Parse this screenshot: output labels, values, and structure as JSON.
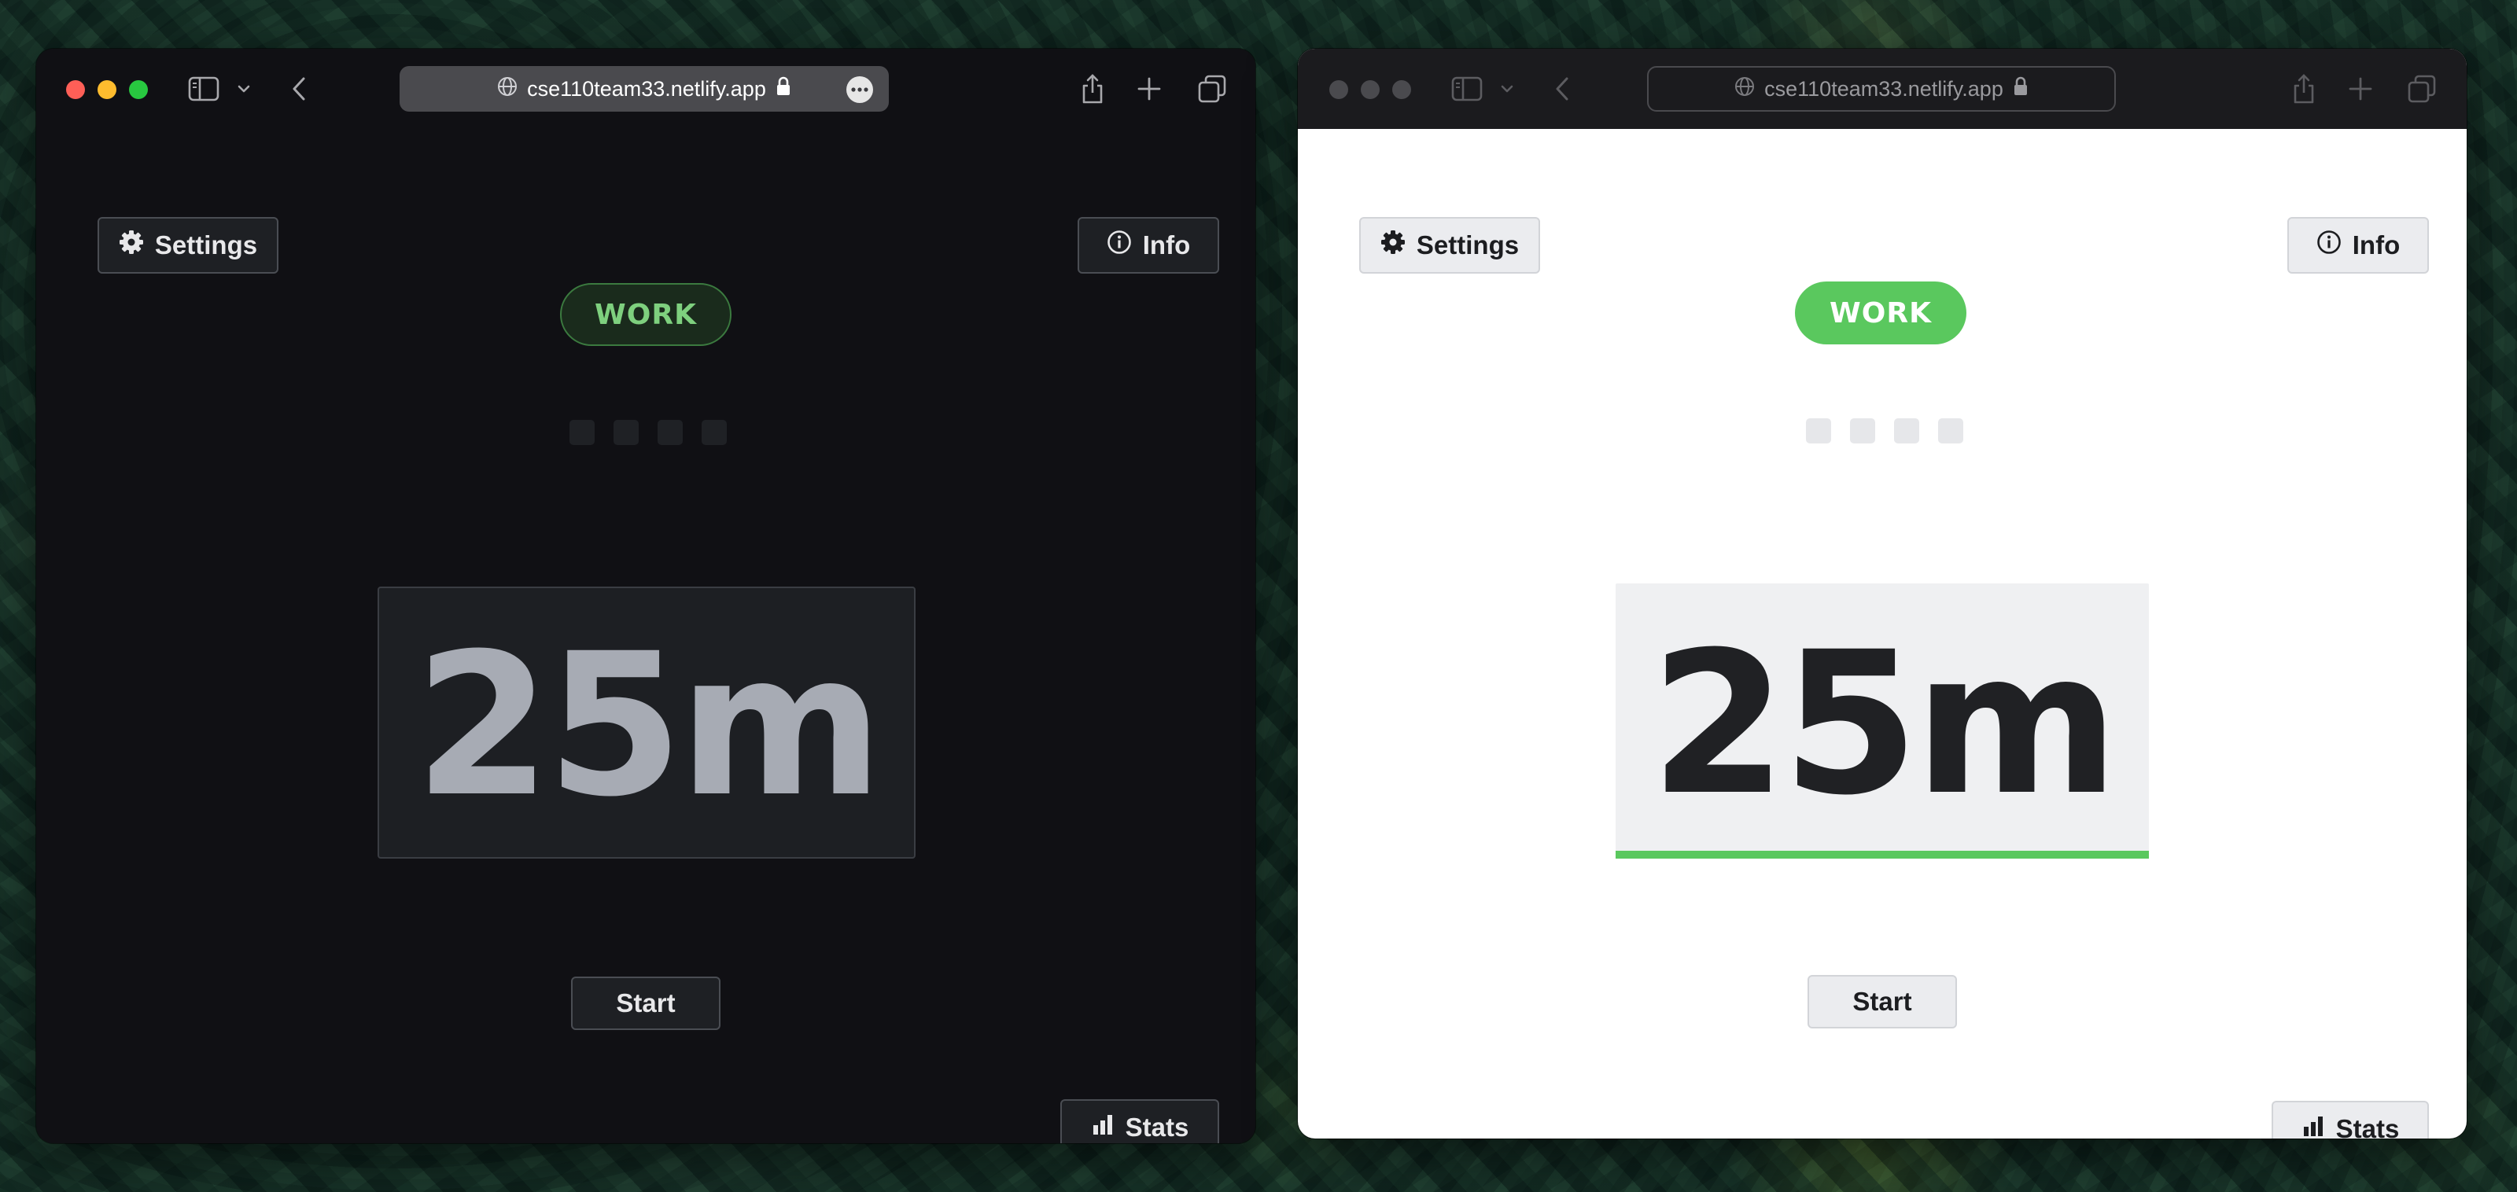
{
  "windows": {
    "dark": {
      "theme": "dark",
      "browser": {
        "url": "cse110team33.netlify.app"
      },
      "app": {
        "settings_label": "Settings",
        "info_label": "Info",
        "mode_label": "WORK",
        "timer_text": "25m",
        "start_label": "Start",
        "stats_label": "Stats",
        "completed_sessions": 0,
        "session_slots": 4,
        "progress_fraction": 0.0
      }
    },
    "light": {
      "theme": "light",
      "browser": {
        "url": "cse110team33.netlify.app"
      },
      "app": {
        "settings_label": "Settings",
        "info_label": "Info",
        "mode_label": "WORK",
        "timer_text": "25m",
        "start_label": "Start",
        "stats_label": "Stats",
        "completed_sessions": 0,
        "session_slots": 4,
        "progress_fraction": 1.0
      }
    }
  },
  "colors": {
    "accent_green": "#5ac85e",
    "dark_background": "#101014",
    "light_background": "#ffffff"
  },
  "icons": [
    "gear-icon",
    "info-icon",
    "bar-chart-icon",
    "globe-icon",
    "lock-icon",
    "sidebar-icon",
    "chevron-down-icon",
    "back-icon",
    "share-icon",
    "new-tab-icon",
    "tab-overview-icon",
    "more-icon"
  ]
}
